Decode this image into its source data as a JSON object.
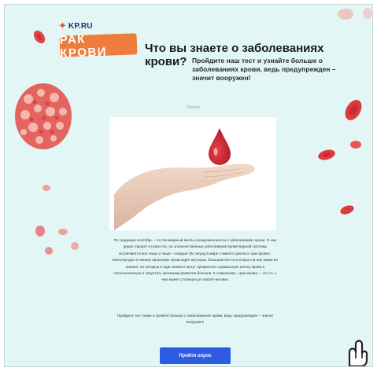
{
  "brand": {
    "kp_logo_text": "KP.RU",
    "badge_text": "РАК КРОВИ",
    "icon": "star-logo-icon"
  },
  "header": {
    "title": "Что вы знаете о заболеваниях крови?",
    "subtitle": "Пройдите наш тест и узнайте больше о заболеваниях крови, ведь предупрежден – значит вооружен!"
  },
  "image_caption": "Вопрос",
  "image_icon": "hand-with-blood-drop-icon",
  "body": {
    "paragraph1": "По традиции сентябрь – это Всемирный месяц осведомленности о заболеваниях крови. О них редко говорят в новостях, но злокачественные заболевания кроветворной системы встречаются все чаще и чаще – каждые 35 секунд в мире ставится диагноз «рак крови». Ежесекундно в нашем организме происходят мутации, большинство из которых на нас никак не влияют, но которые в один момент могут превратить нормальную клетку крови в патологическую и запустить механизм развития болезни. К сожалению, «рак крови» – это то, с чем может столкнуться любой человек.",
    "paragraph2": "Пройдите тест ниже и узнайте больше о заболеваниях крови, ведь предупрежден – значит вооружен!"
  },
  "cta": {
    "label": "Пройти опрос"
  },
  "colors": {
    "background": "#e2f7f5",
    "accent_orange": "#ee7c3d",
    "button_blue": "#2d5be3",
    "blood_red": "#d8323a"
  },
  "decor_icons": [
    "red-blood-cell-icon",
    "cell-cluster-icon",
    "pointing-hand-icon"
  ]
}
